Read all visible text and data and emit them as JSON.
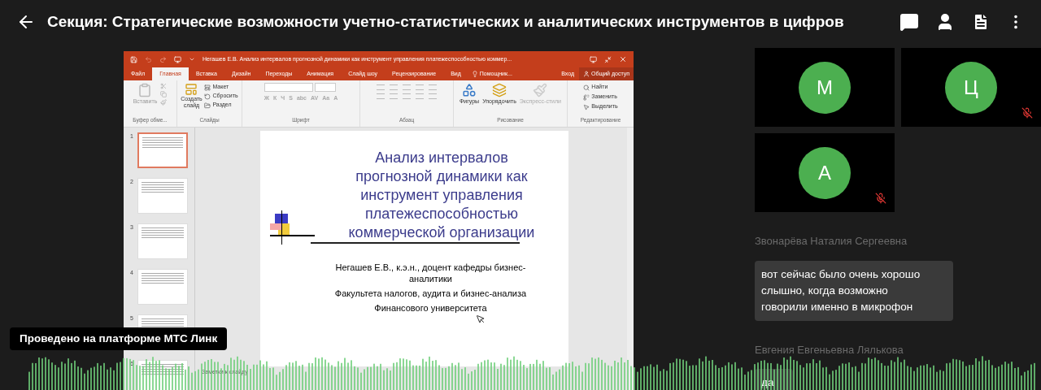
{
  "header": {
    "title": "Секция: Стратегические возможности учетно-статистических и аналитических инструментов в цифров"
  },
  "shared_screen": {
    "window_title": "Негашев Е.В. Анализ интервалов прогнозной динамики как инструмент управления платежеспособностью коммер...",
    "tabs": [
      {
        "label": "Файл",
        "selected": false
      },
      {
        "label": "Главная",
        "selected": true
      },
      {
        "label": "Вставка",
        "selected": false
      },
      {
        "label": "Дизайн",
        "selected": false
      },
      {
        "label": "Переходы",
        "selected": false
      },
      {
        "label": "Анимация",
        "selected": false
      },
      {
        "label": "Слайд шоу",
        "selected": false
      },
      {
        "label": "Рецензирование",
        "selected": false
      },
      {
        "label": "Вид",
        "selected": false
      }
    ],
    "tell_me": "Помощник...",
    "sign_in": "Вход",
    "share": "Общий доступ",
    "ribbon": {
      "clipboard": {
        "label": "Буфер обме...",
        "paste": "Вставить"
      },
      "slides": {
        "label": "Слайды",
        "new_slide": "Создать слайд",
        "layout": "Макет",
        "reset": "Сбросить",
        "section": "Раздел"
      },
      "font": {
        "label": "Шрифт",
        "buttons": [
          "Ж",
          "К",
          "Ч",
          "S",
          "abc",
          "AV",
          "Aa",
          "A"
        ]
      },
      "paragraph": {
        "label": "Абзац"
      },
      "drawing": {
        "label": "Рисование",
        "shapes": "Фигуры",
        "arrange": "Упорядочить",
        "quick_styles": "Экспресс-стили"
      },
      "editing": {
        "label": "Редактирование",
        "find": "Найти",
        "replace": "Заменить",
        "select": "Выделить"
      }
    },
    "thumbnails": [
      {
        "number": "1",
        "selected": true
      },
      {
        "number": "2",
        "selected": false
      },
      {
        "number": "3",
        "selected": false
      },
      {
        "number": "4",
        "selected": false
      },
      {
        "number": "5",
        "selected": false
      },
      {
        "number": "6",
        "selected": false
      }
    ],
    "slide": {
      "title_lines": [
        "Анализ интервалов",
        "прогнозной динамики как",
        "инструмент управления",
        "платежеспособностью",
        "коммерческой организации"
      ],
      "body_lines": [
        "Негашев Е.В., к.э.н., доцент кафедры бизнес-аналитики",
        "Факультета налогов, аудита и бизнес-анализа",
        "Финансового университета"
      ]
    },
    "notes": "Заметки к слайду"
  },
  "platform_badge": "Проведено на платформе МТС Линк",
  "participants": [
    {
      "initial": "М",
      "muted": false
    },
    {
      "initial": "Ц",
      "muted": true
    },
    {
      "initial": "А",
      "muted": true
    }
  ],
  "chat": [
    {
      "author": "Звонарёва Наталия Сергеевна",
      "text": "вот сейчас было очень хорошо слышно, когда возможно говорили именно в микрофон"
    },
    {
      "author": "Евгения Евгеньевна Лялькова",
      "text": "да"
    }
  ]
}
